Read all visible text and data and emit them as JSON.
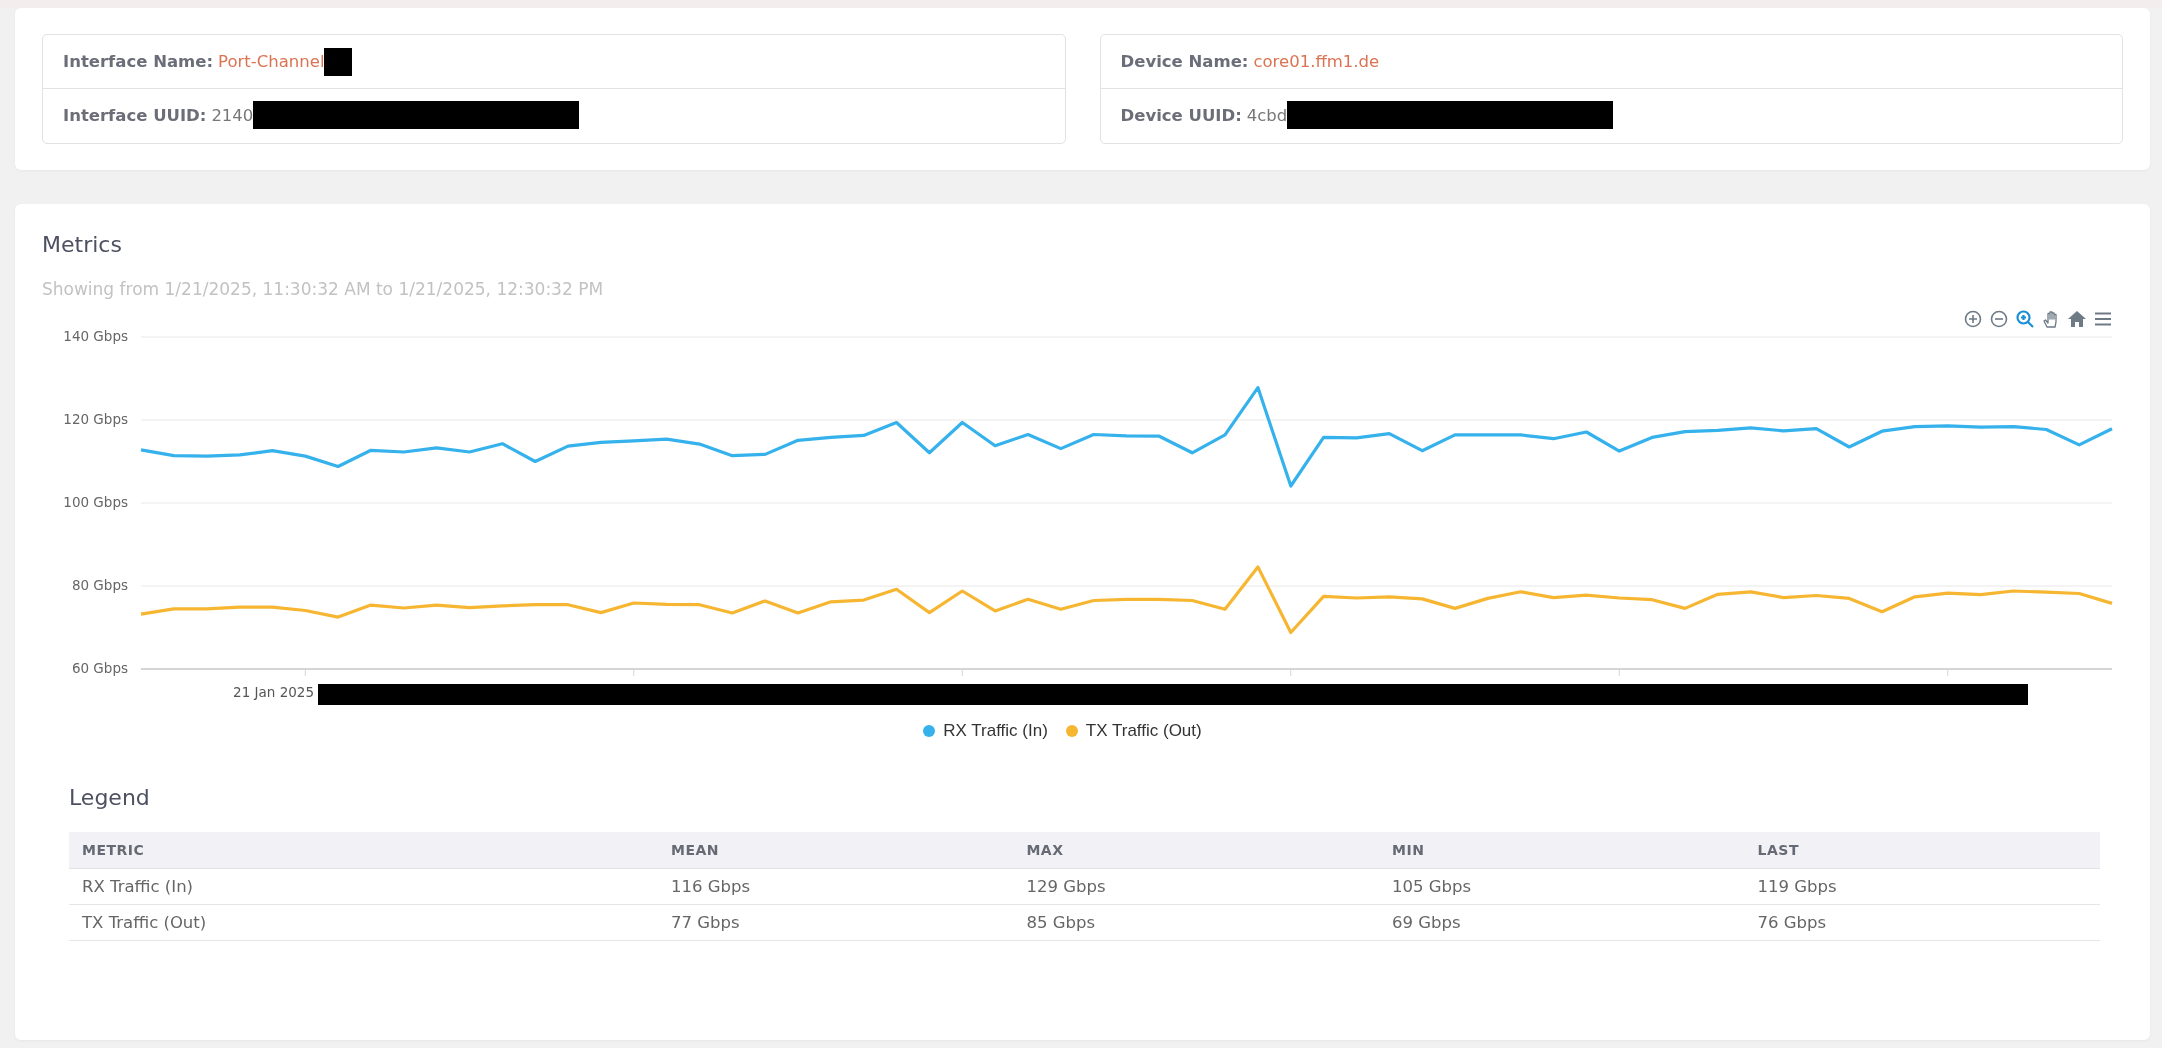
{
  "info_cards": [
    {
      "rows": [
        {
          "label": "Interface Name:",
          "value": "Port-Channel",
          "kind": "link",
          "redacted": true
        },
        {
          "label": "Interface UUID:",
          "value": "2140",
          "kind": "text",
          "redacted": true
        }
      ]
    },
    {
      "rows": [
        {
          "label": "Device Name:",
          "value": "core01.ffm1.de",
          "kind": "link",
          "redacted": false
        },
        {
          "label": "Device UUID:",
          "value": "4cbd",
          "kind": "text",
          "redacted": true
        }
      ]
    }
  ],
  "metrics": {
    "title": "Metrics",
    "range_text": "Showing from 1/21/2025, 11:30:32 AM to 1/21/2025, 12:30:32 PM",
    "toolbar": [
      {
        "kind": "zoom_in",
        "selected": false
      },
      {
        "kind": "zoom_out",
        "selected": false
      },
      {
        "kind": "zoom_select",
        "selected": true
      },
      {
        "kind": "pan",
        "selected": false
      },
      {
        "kind": "reset",
        "selected": false
      },
      {
        "kind": "menu",
        "selected": false
      }
    ],
    "x_axis": {
      "label": "21 Jan 2025",
      "redacted": true
    },
    "chart_data": {
      "type": "line",
      "ylim": [
        60,
        140
      ],
      "grid": true,
      "yticks": [
        {
          "value": 60,
          "label": "60 Gbps"
        },
        {
          "value": 80,
          "label": "80 Gbps"
        },
        {
          "value": 100,
          "label": "100 Gbps"
        },
        {
          "value": 120,
          "label": "120 Gbps"
        },
        {
          "value": 140,
          "label": "140 Gbps"
        }
      ],
      "series": [
        {
          "name": "RX Traffic (In)",
          "color": "#35b1ec",
          "values": [
            112.8,
            111.4,
            111.3,
            111.6,
            112.6,
            111.3,
            108.8,
            112.7,
            112.3,
            113.3,
            112.3,
            114.3,
            110,
            113.7,
            114.6,
            115,
            115.4,
            114.2,
            111.4,
            111.7,
            115.1,
            115.8,
            116.3,
            119.4,
            112.1,
            119.4,
            113.8,
            116.5,
            113.1,
            116.5,
            116.2,
            116.1,
            112.1,
            116.4,
            127.8,
            104.1,
            115.8,
            115.7,
            116.7,
            112.6,
            116.4,
            116.4,
            116.4,
            115.5,
            117.1,
            112.5,
            115.8,
            117.2,
            117.5,
            118.1,
            117.4,
            117.9,
            113.5,
            117.3,
            118.4,
            118.6,
            118.3,
            118.4,
            117.7,
            114,
            117.9
          ]
        },
        {
          "name": "TX Traffic (Out)",
          "color": "#f6b632",
          "values": [
            73.2,
            74.5,
            74.5,
            74.9,
            74.9,
            74.1,
            72.5,
            75.4,
            74.7,
            75.4,
            74.8,
            75.2,
            75.5,
            75.5,
            73.6,
            75.9,
            75.6,
            75.5,
            73.5,
            76.4,
            73.5,
            76.2,
            76.6,
            79.2,
            73.6,
            78.8,
            74,
            76.8,
            74.4,
            76.5,
            76.8,
            76.8,
            76.5,
            74.4,
            84.6,
            68.8,
            77.5,
            77.1,
            77.4,
            76.9,
            74.6,
            77,
            78.6,
            77.2,
            77.8,
            77.1,
            76.7,
            74.6,
            78,
            78.6,
            77.2,
            77.7,
            77,
            73.8,
            77.4,
            78.3,
            77.9,
            78.8,
            78.5,
            78.2,
            75.8
          ]
        }
      ]
    }
  },
  "legend": {
    "title": "Legend",
    "columns": [
      "METRIC",
      "MEAN",
      "MAX",
      "MIN",
      "LAST"
    ],
    "rows": [
      [
        "RX Traffic (In)",
        "116 Gbps",
        "129 Gbps",
        "105 Gbps",
        "119 Gbps"
      ],
      [
        "TX Traffic (Out)",
        "77 Gbps",
        "85 Gbps",
        "69 Gbps",
        "76 Gbps"
      ]
    ]
  }
}
